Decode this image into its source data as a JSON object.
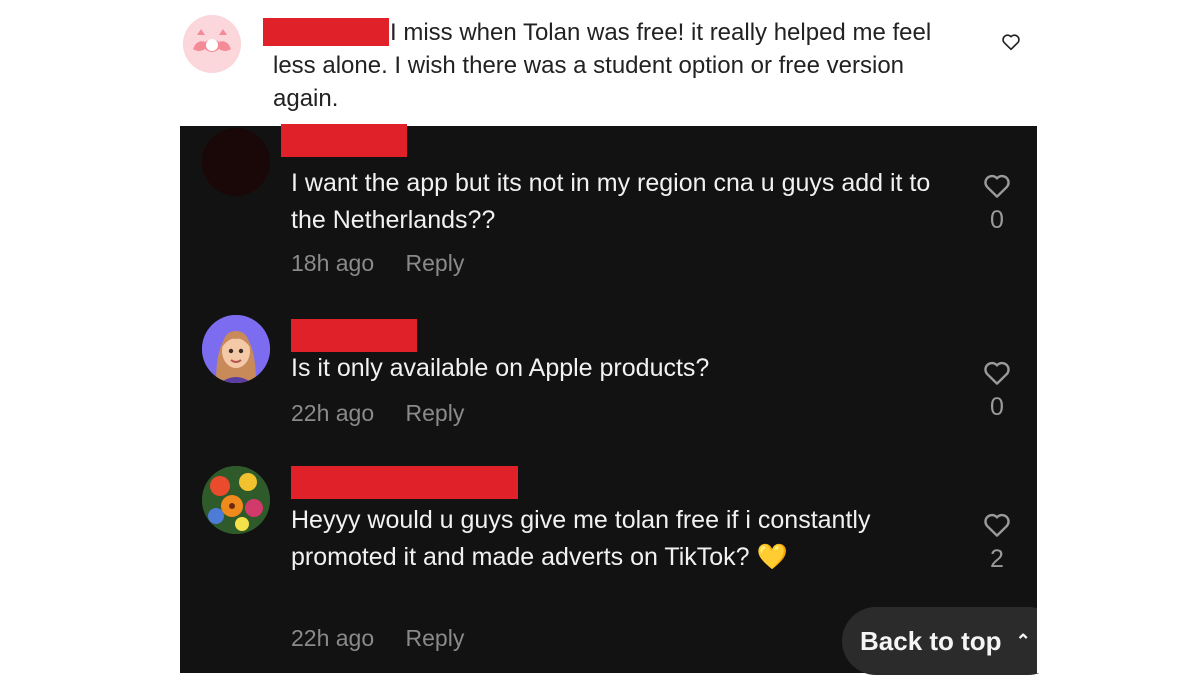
{
  "top_comment": {
    "text": "I miss when Tolan was free! it really helped me feel less alone. I wish there was a student option or free version again."
  },
  "comments": [
    {
      "text": "I want the app but its not in my region cna u guys add it to the Netherlands??",
      "time": "18h ago",
      "reply_label": "Reply",
      "likes": "0"
    },
    {
      "text": "Is it only available on Apple products?",
      "time": "22h ago",
      "reply_label": "Reply",
      "likes": "0"
    },
    {
      "text": "Heyyy would u guys give me tolan free if i constantly promoted it and made adverts on TikTok? 💛",
      "time": "22h ago",
      "reply_label": "Reply",
      "likes": "2"
    }
  ],
  "back_to_top": {
    "label": "Back to top"
  },
  "colors": {
    "redaction": "#e0212a",
    "panel_bg": "#121212",
    "meta_text": "#8a8a8a"
  },
  "icons": {
    "like": "heart-outline-icon",
    "back_to_top": "double-chevron-up-icon"
  }
}
